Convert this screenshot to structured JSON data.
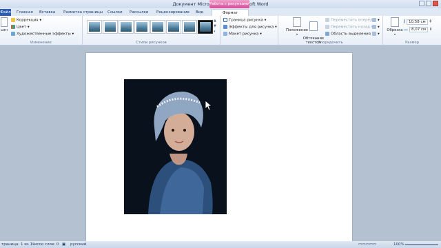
{
  "window": {
    "title": "Документ Microsoft Word  -  Microsoft Word",
    "context_group": "Работа с рисунками"
  },
  "tabs": [
    {
      "label": "Файл"
    },
    {
      "label": "Главная"
    },
    {
      "label": "Вставка"
    },
    {
      "label": "Разметка страницы"
    },
    {
      "label": "Ссылки"
    },
    {
      "label": "Рассылки"
    },
    {
      "label": "Рецензирование"
    },
    {
      "label": "Вид"
    },
    {
      "label": "Формат"
    }
  ],
  "ribbon": {
    "adjust": {
      "button_label": "ьон",
      "items": [
        "Коррекция",
        "Цвет",
        "Художественные эффекты"
      ],
      "label": "Изменение"
    },
    "styles": {
      "label": "Стили рисунков",
      "thumb_count": 8
    },
    "style_opts": {
      "items": [
        "Граница рисунка",
        "Эффекты для рисунка",
        "Макет рисунка"
      ]
    },
    "arrange": {
      "position": "Положение",
      "wrap": "Обтекание\nтекстом",
      "items": [
        "Переместить вперед",
        "Переместить назад",
        "Область выделения"
      ],
      "label": "Упорядочить"
    },
    "size": {
      "crop": "Обрезка",
      "height": "10,58 см",
      "width": "8,07 см",
      "label": "Размер"
    }
  },
  "status": {
    "page": "траница: 1 из 1",
    "words": "Число слов: 0",
    "language": "русский",
    "zoom": "100%"
  },
  "colors": {
    "ribbon_tab_file": "#2a5db3",
    "context_tab": "#d64f9b",
    "document_bg": "#b4c1d1"
  }
}
